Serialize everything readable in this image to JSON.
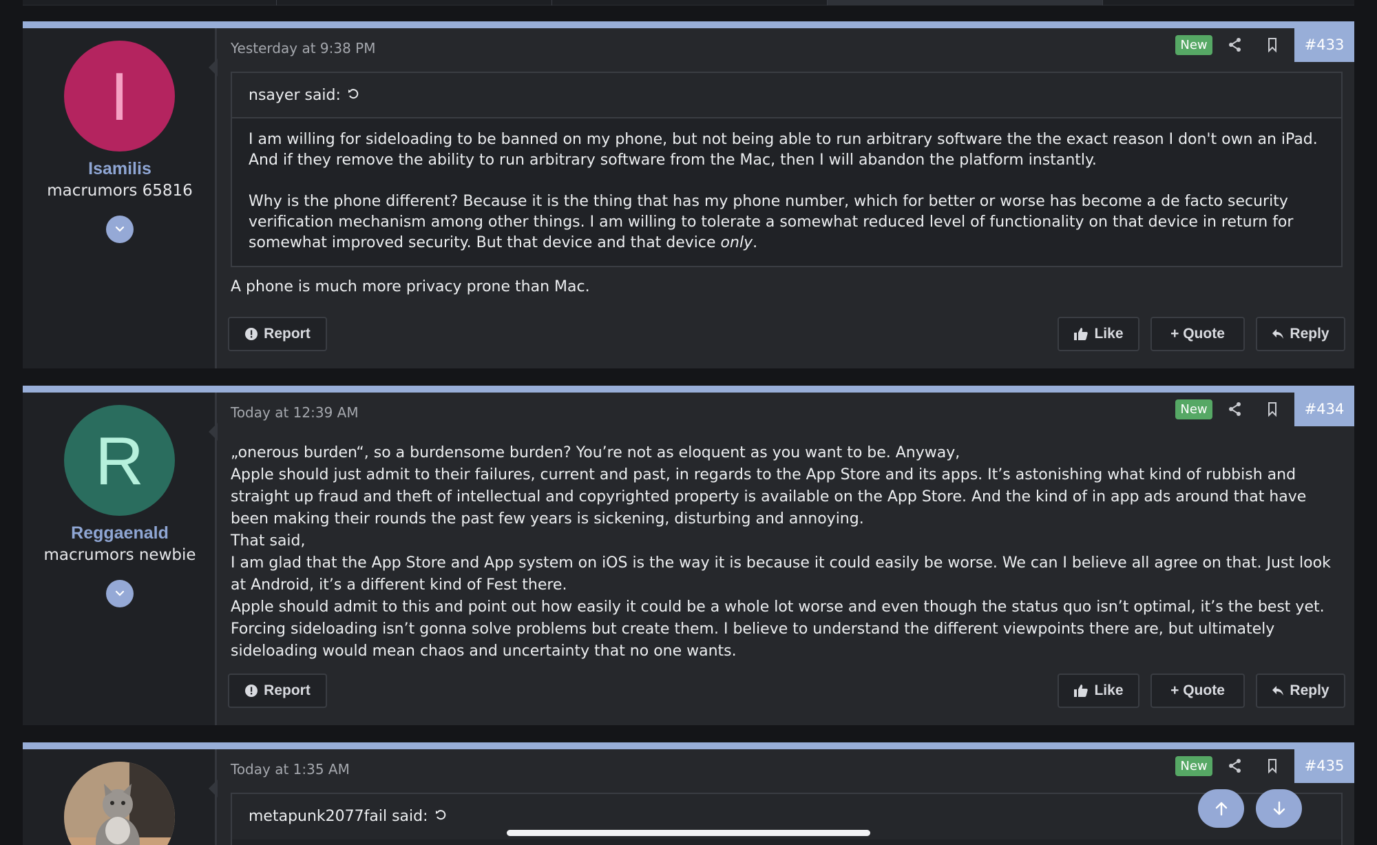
{
  "colors": {
    "accent": "#98aed8",
    "new_badge": "#56a865",
    "avatar_1": "#b4245f",
    "avatar_1_letter": "#f5a1c3",
    "avatar_2": "#2a6d5e",
    "avatar_2_letter": "#b6f0dc",
    "background": "#141518",
    "panel": "#26282c"
  },
  "icons": {
    "share": "share-icon",
    "bookmark": "bookmark-icon",
    "expand": "chevron-down-icon",
    "report": "exclamation-circle-icon",
    "like": "thumbs-up-icon",
    "quote": "plus-icon",
    "reply": "reply-arrow-icon",
    "scroll_up": "arrow-up-icon",
    "scroll_down": "arrow-down-icon"
  },
  "actions": {
    "report": "Report",
    "like": "Like",
    "quote": "+ Quote",
    "reply": "Reply"
  },
  "posts": [
    {
      "number": "#433",
      "badge": "New",
      "date": "Yesterday at 9:38 PM",
      "user": {
        "name": "Isamilis",
        "title": "macrumors 65816",
        "avatar_letter": "I"
      },
      "quote": {
        "author": "nsayer said:",
        "paragraphs": [
          "I am willing for sideloading to be banned on my phone, but not being able to run arbitrary software the the exact reason I don't own an iPad. And if they remove the ability to run arbitrary software from the Mac, then I will abandon the platform instantly.",
          "Why is the phone different? Because it is the thing that has my phone number, which for better or worse has become a de facto security verification mechanism among other things. I am willing to tolerate a somewhat reduced level of functionality on that device in return for somewhat improved security. But that device and that device ",
          "only",
          "."
        ]
      },
      "body": [
        "A phone is much more privacy prone than Mac."
      ]
    },
    {
      "number": "#434",
      "badge": "New",
      "date": "Today at 12:39 AM",
      "user": {
        "name": "Reggaenald",
        "title": "macrumors newbie",
        "avatar_letter": "R"
      },
      "body": [
        "„onerous burden“, so a burdensome burden? You’re not as eloquent as you want to be. Anyway,",
        "Apple should just admit to their failures, current and past, in regards to the App Store and its apps. It’s astonishing what kind of rubbish and straight up fraud and theft of intellectual and copyrighted property is available on the App Store. And the kind of in app ads around that have been making their rounds the past few years is sickening, disturbing and annoying.",
        "That said,",
        "I am glad that the App Store and App system on iOS is the way it is because it could easily be worse. We can I believe all agree on that. Just look at Android, it’s a different kind of Fest there.",
        "Apple should admit to this and point out how easily it could be a whole lot worse and even though the status quo isn’t optimal, it’s the best yet. Forcing sideloading isn’t gonna solve problems but create them. I believe to understand the different viewpoints there are, but ultimately sideloading would mean chaos and uncertainty that no one wants."
      ]
    },
    {
      "number": "#435",
      "badge": "New",
      "date": "Today at 1:35 AM",
      "quote": {
        "author": "metapunk2077fail said:"
      }
    }
  ]
}
